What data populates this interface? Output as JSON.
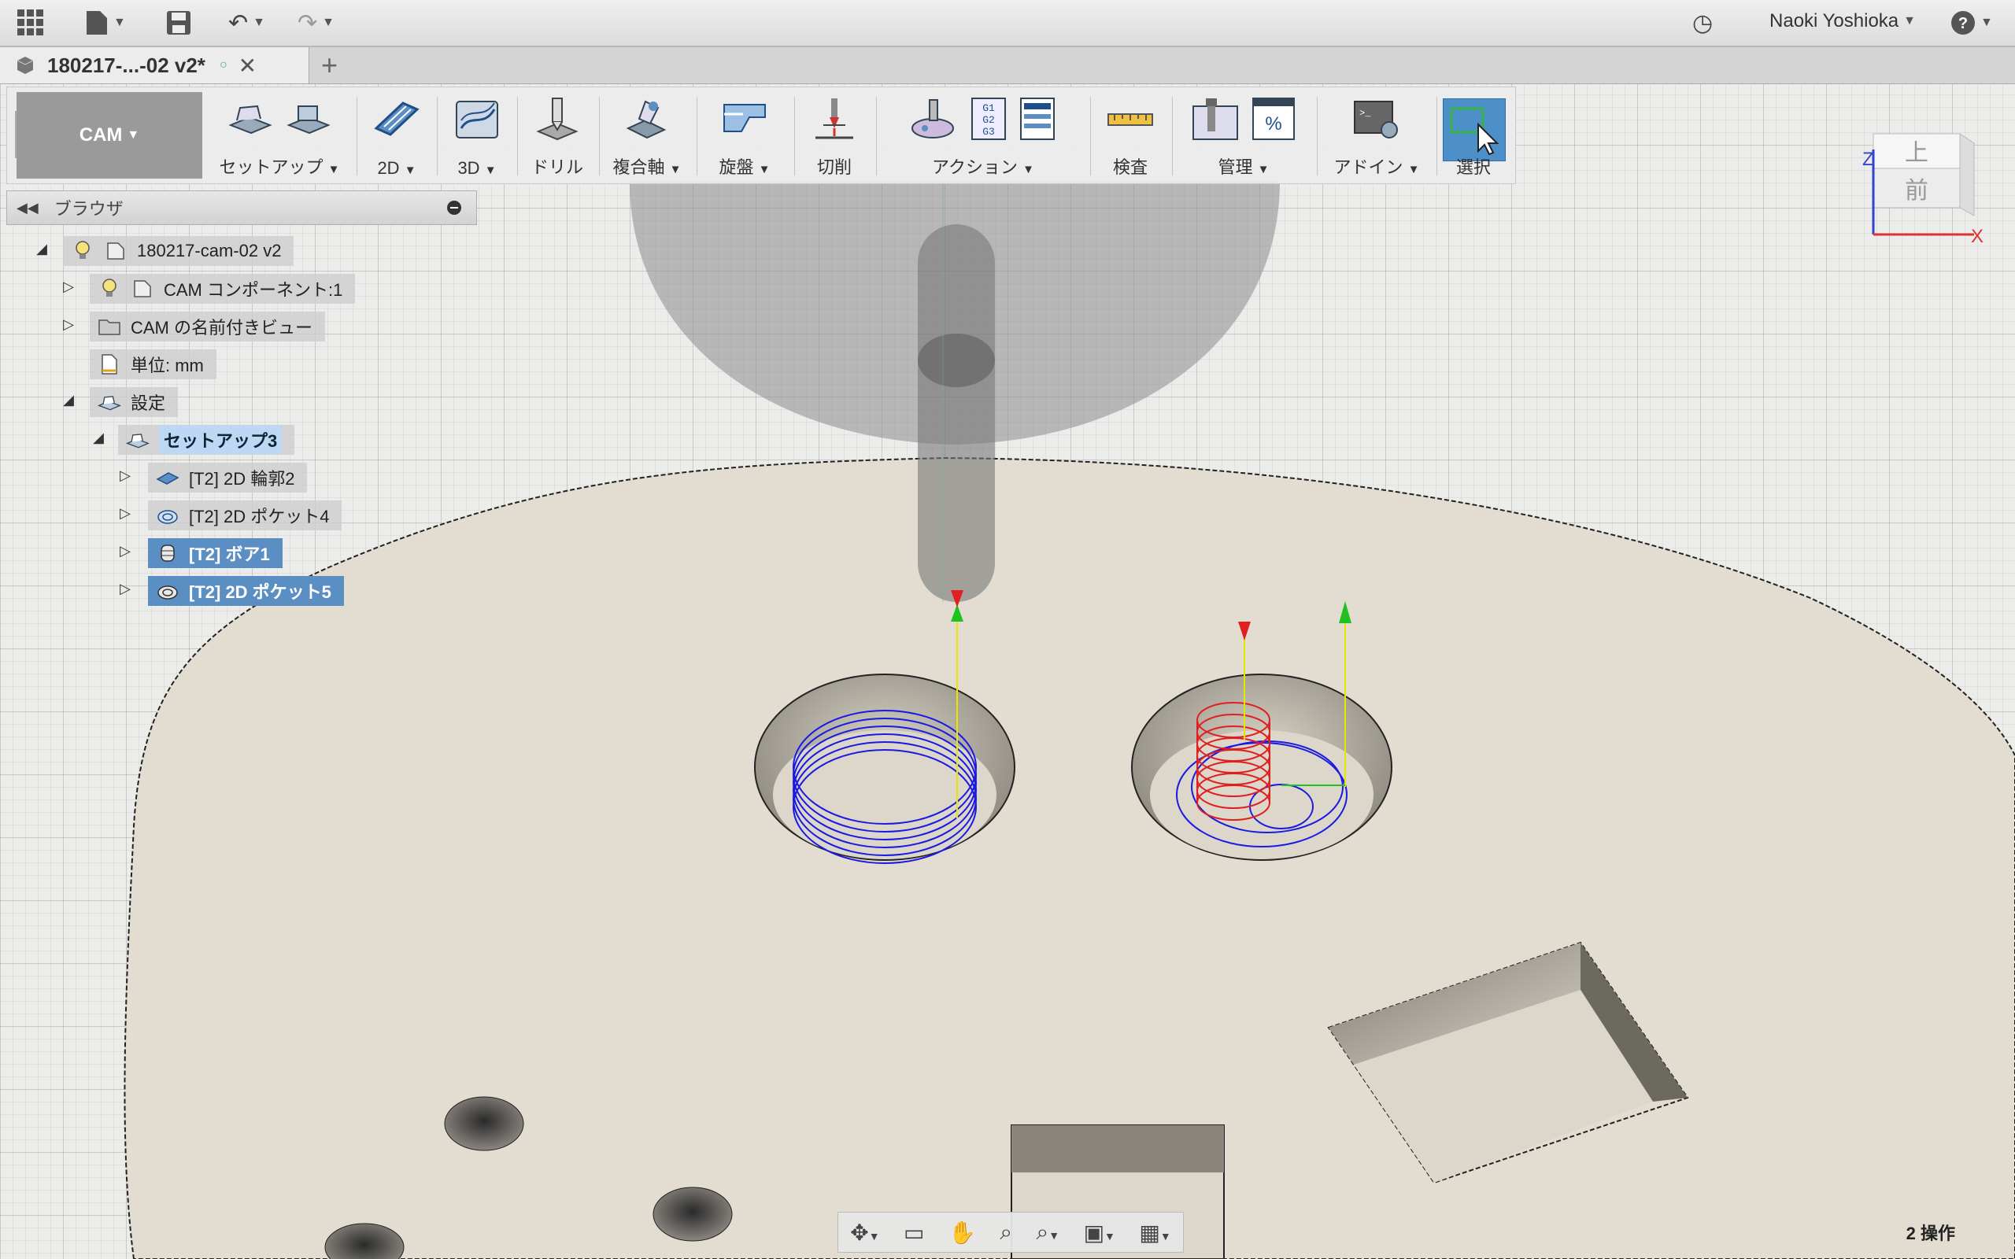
{
  "topbar": {
    "user_name": "Naoki Yoshioka"
  },
  "tab": {
    "title": "180217-...-02 v2*"
  },
  "toolbar": {
    "workspace": "CAM",
    "groups": [
      {
        "label": "セットアップ"
      },
      {
        "label": "2D"
      },
      {
        "label": "3D"
      },
      {
        "label": "ドリル"
      },
      {
        "label": "複合軸"
      },
      {
        "label": "旋盤"
      },
      {
        "label": "切削"
      },
      {
        "label": "アクション"
      },
      {
        "label": "検査"
      },
      {
        "label": "管理"
      },
      {
        "label": "アドイン"
      },
      {
        "label": "選択"
      }
    ]
  },
  "browser": {
    "title": "ブラウザ",
    "root": "180217-cam-02 v2",
    "items": [
      {
        "label": "CAM コンポーネント:1"
      },
      {
        "label": "CAM の名前付きビュー"
      },
      {
        "label": "単位: mm"
      },
      {
        "label": "設定"
      },
      {
        "label": "セットアップ3"
      },
      {
        "label": "[T2] 2D 輪郭2"
      },
      {
        "label": "[T2] 2D ポケット4"
      },
      {
        "label": "[T2] ボア1"
      },
      {
        "label": "[T2] 2D ポケット5"
      }
    ]
  },
  "viewcube": {
    "top": "上",
    "front": "前",
    "axis_z": "Z",
    "axis_x": "X"
  },
  "status": {
    "ops": "2 操作"
  },
  "colors": {
    "accent": "#5b8ec2",
    "toolpath_blue": "#1a1ae0",
    "toolpath_red": "#e02020",
    "stock": "#e2ddd0"
  }
}
